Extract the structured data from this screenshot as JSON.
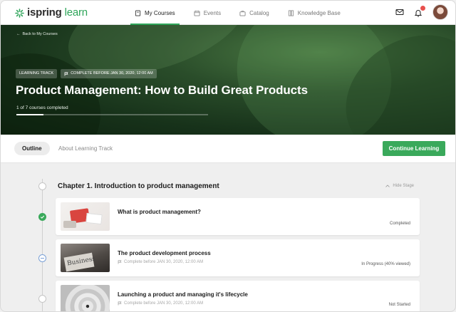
{
  "header": {
    "logo_main": "ispring",
    "logo_accent": "learn",
    "nav": [
      {
        "label": "My Courses",
        "icon": "book-icon",
        "active": true
      },
      {
        "label": "Events",
        "icon": "calendar-icon",
        "active": false
      },
      {
        "label": "Catalog",
        "icon": "catalog-icon",
        "active": false
      },
      {
        "label": "Knowledge Base",
        "icon": "library-icon",
        "active": false
      }
    ],
    "notification_count": "4"
  },
  "hero": {
    "back_label": "Back to My Courses",
    "type_chip": "LEARNING TRACK",
    "deadline_chip": "COMPLETE BEFORE JAN 30, 2020, 12:00 AM",
    "title": "Product Management: How to Build Great Products",
    "progress_text": "1 of 7 courses completed",
    "progress_fraction": 0.1429
  },
  "tabs": {
    "outline": "Outline",
    "about": "About Learning Track",
    "continue_button": "Continue Learning"
  },
  "chapter": {
    "title": "Chapter 1. Introduction to product management",
    "hide_label": "Hide Stage"
  },
  "courses": [
    {
      "title": "What is product management?",
      "subtitle": "",
      "status": "Completed"
    },
    {
      "title": "The product development process",
      "subtitle": "Complete before JAN 30, 2020, 12:00 AM",
      "status": "In Progress (40% viewed)"
    },
    {
      "title": "Launching a product and managing it's lifecycle",
      "subtitle": "Complete before JAN 30, 2020, 12:00 AM",
      "status": "Not Started"
    }
  ],
  "colors": {
    "brand": "#3aa95b",
    "badge": "#e8504d"
  }
}
